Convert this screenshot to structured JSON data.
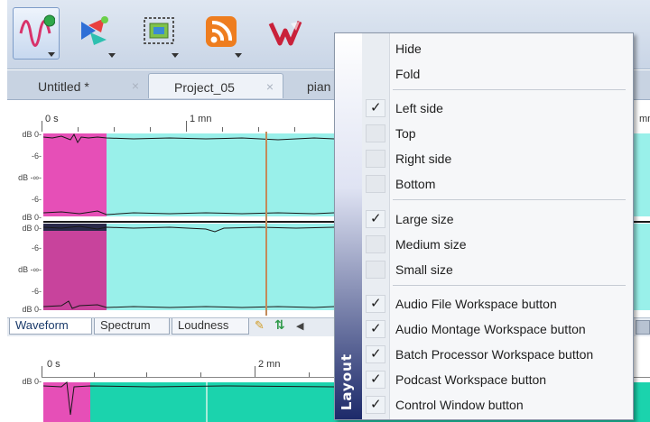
{
  "colors": {
    "accent_pink": "#e64fb7",
    "accent_cyan": "#99f0ea",
    "accent_teal": "#1bd3ad",
    "playhead": "#c38b5a",
    "menu_strip_dark": "#1d2a6a"
  },
  "toolbar": {
    "buttons": [
      {
        "icon": "audio-file-workspace-icon"
      },
      {
        "icon": "audio-montage-workspace-icon"
      },
      {
        "icon": "batch-processor-workspace-icon"
      },
      {
        "icon": "podcast-workspace-icon"
      },
      {
        "icon": "control-window-icon"
      }
    ]
  },
  "tabs": [
    {
      "label": "Untitled *",
      "close": "×"
    },
    {
      "label": "Project_05",
      "close": "×"
    },
    {
      "label": "pian"
    }
  ],
  "ruler_top": {
    "labels": [
      "0 s",
      "1 mn",
      "mn"
    ]
  },
  "ruler_bottom": {
    "labels": [
      "0 s",
      "2 mn"
    ]
  },
  "db_labels": [
    "dB 0-",
    "-6-",
    "dB -∞-",
    "-6-",
    "dB 0-",
    "dB 0-",
    "-6-",
    "dB -∞-",
    "-6-",
    "dB 0-"
  ],
  "db_label_bottom": "dB 0-",
  "view_tabs": [
    "Waveform",
    "Spectrum",
    "Loudness"
  ],
  "menu": {
    "title": "Layout",
    "groups": [
      [
        {
          "label": "Hide",
          "checked": false,
          "show_box": false
        },
        {
          "label": "Fold",
          "checked": false,
          "show_box": false
        }
      ],
      [
        {
          "label": "Left side",
          "checked": true,
          "show_box": true
        },
        {
          "label": "Top",
          "checked": false,
          "show_box": true
        },
        {
          "label": "Right side",
          "checked": false,
          "show_box": true
        },
        {
          "label": "Bottom",
          "checked": false,
          "show_box": true
        }
      ],
      [
        {
          "label": "Large size",
          "checked": true,
          "show_box": true
        },
        {
          "label": "Medium size",
          "checked": false,
          "show_box": true
        },
        {
          "label": "Small size",
          "checked": false,
          "show_box": true
        }
      ],
      [
        {
          "label": "Audio File Workspace button",
          "checked": true,
          "show_box": true
        },
        {
          "label": "Audio Montage Workspace button",
          "checked": true,
          "show_box": true
        },
        {
          "label": "Batch Processor Workspace button",
          "checked": true,
          "show_box": true
        },
        {
          "label": "Podcast Workspace button",
          "checked": true,
          "show_box": true
        },
        {
          "label": "Control Window button",
          "checked": true,
          "show_box": true
        }
      ]
    ],
    "check_glyph": "✓"
  }
}
